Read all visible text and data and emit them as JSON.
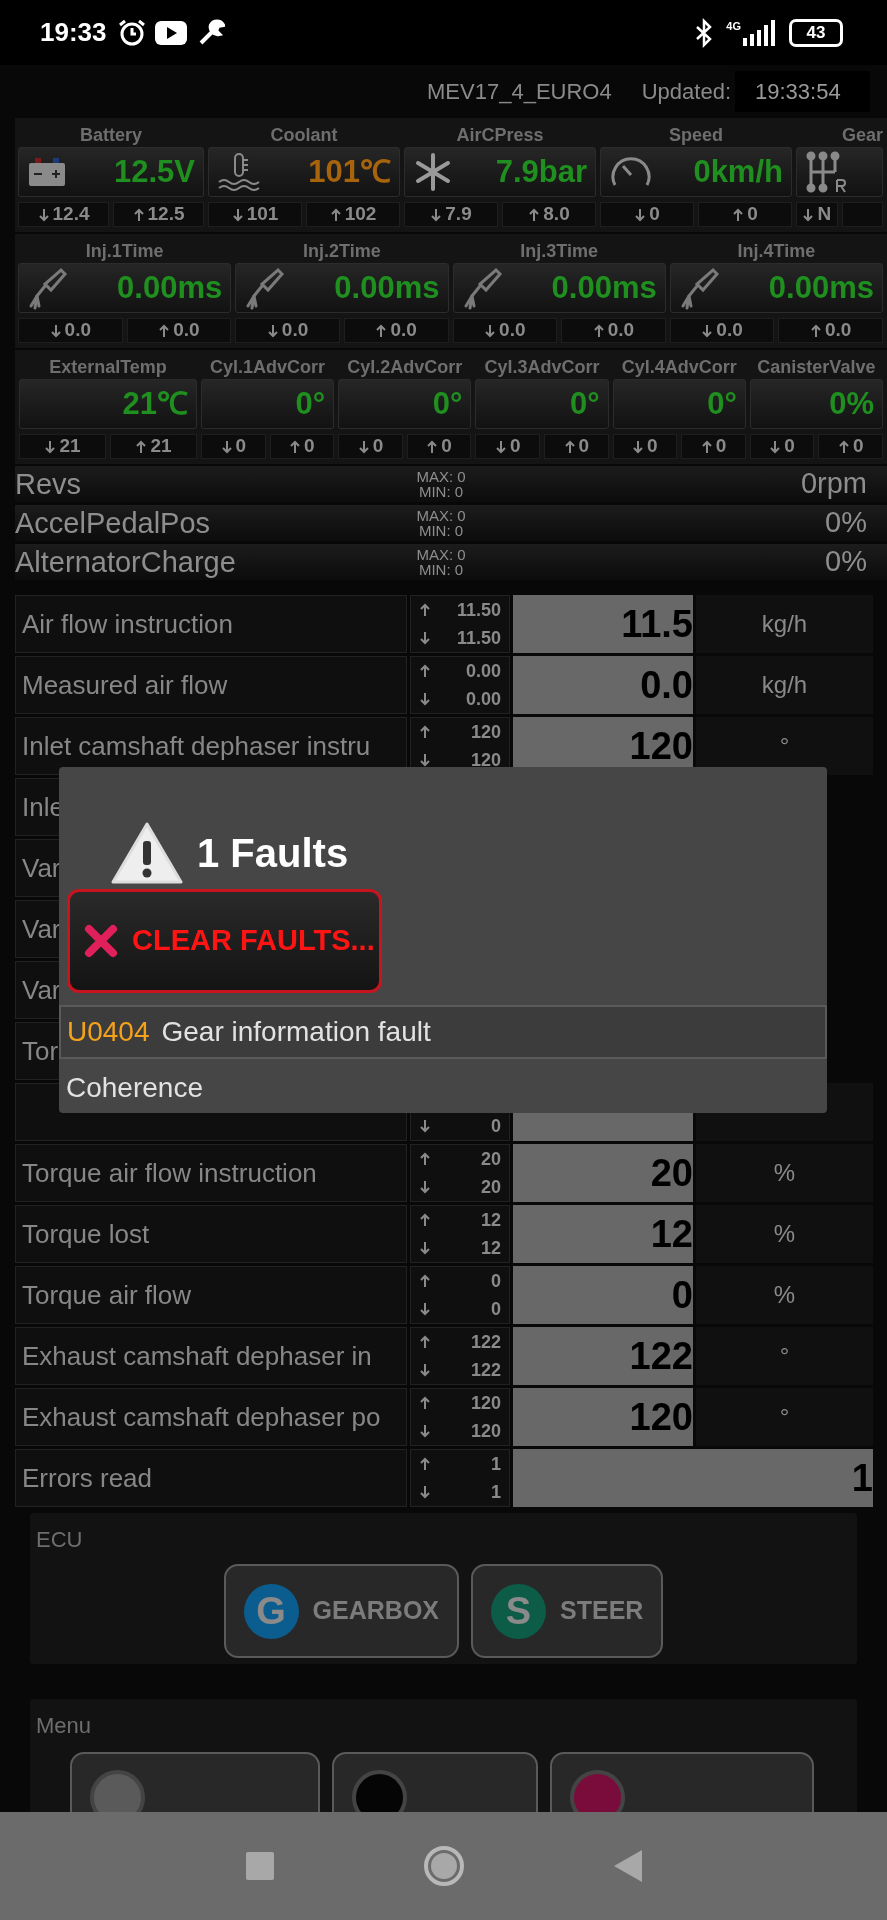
{
  "status_bar": {
    "time": "19:33",
    "network": "4G",
    "battery": "43"
  },
  "header": {
    "ecu": "MEV17_4_EURO4",
    "updated_label": "Updated:",
    "updated_time": "19:33:54"
  },
  "gauge_rows": [
    {
      "gauges": [
        {
          "label": "Battery",
          "kind": "battery",
          "value": "12.5V",
          "color": "#1f8f1f",
          "min": "12.4",
          "max": "12.5"
        },
        {
          "label": "Coolant",
          "kind": "thermometer",
          "value": "101℃",
          "color": "#a8640c",
          "min": "101",
          "max": "102"
        },
        {
          "label": "AirCPress",
          "kind": "snowflake",
          "value": "7.9bar",
          "color": "#1f8f1f",
          "min": "7.9",
          "max": "8.0"
        },
        {
          "label": "Speed",
          "kind": "speedometer",
          "value": "0km/h",
          "color": "#1f8f1f",
          "min": "0",
          "max": "0"
        },
        {
          "label": "Gear",
          "kind": "gearshift",
          "min": "N"
        }
      ]
    },
    {
      "gauges": [
        {
          "label": "Inj.1Time",
          "kind": "injector",
          "value": "0.00ms",
          "color": "#1f8f1f",
          "min": "0.0",
          "max": "0.0"
        },
        {
          "label": "Inj.2Time",
          "kind": "injector",
          "value": "0.00ms",
          "color": "#1f8f1f",
          "min": "0.0",
          "max": "0.0"
        },
        {
          "label": "Inj.3Time",
          "kind": "injector",
          "value": "0.00ms",
          "color": "#1f8f1f",
          "min": "0.0",
          "max": "0.0"
        },
        {
          "label": "Inj.4Time",
          "kind": "injector",
          "value": "0.00ms",
          "color": "#1f8f1f",
          "min": "0.0",
          "max": "0.0"
        }
      ]
    },
    {
      "gauges": [
        {
          "label": "ExternalTemp",
          "value": "21℃",
          "color": "#1f8f1f",
          "min": "21",
          "max": "21"
        },
        {
          "label": "Cyl.1AdvCorr",
          "value": "0°",
          "color": "#1f8f1f",
          "min": "0",
          "max": "0"
        },
        {
          "label": "Cyl.2AdvCorr",
          "value": "0°",
          "color": "#1f8f1f",
          "min": "0",
          "max": "0"
        },
        {
          "label": "Cyl.3AdvCorr",
          "value": "0°",
          "color": "#1f8f1f",
          "min": "0",
          "max": "0"
        },
        {
          "label": "Cyl.4AdvCorr",
          "value": "0°",
          "color": "#1f8f1f",
          "min": "0",
          "max": "0"
        },
        {
          "label": "CanisterValve",
          "value": "0%",
          "color": "#1f8f1f",
          "min": "0",
          "max": "0"
        }
      ]
    }
  ],
  "bars": [
    {
      "label": "Revs",
      "max": "MAX: 0",
      "min": "MIN: 0",
      "value": "0rpm"
    },
    {
      "label": "AccelPedalPos",
      "max": "MAX: 0",
      "min": "MIN: 0",
      "value": "0%"
    },
    {
      "label": "AlternatorCharge",
      "max": "MAX: 0",
      "min": "MIN: 0",
      "value": "0%"
    }
  ],
  "table": {
    "rows": [
      {
        "name": "Air flow instruction",
        "max": "11.50",
        "min": "11.50",
        "value": "11.5",
        "unit": "kg/h"
      },
      {
        "name": "Measured air flow",
        "max": "0.00",
        "min": "0.00",
        "value": "0.0",
        "unit": "kg/h"
      },
      {
        "name": "Inlet camshaft dephaser instru",
        "max": "120",
        "min": "120",
        "value": "120",
        "unit": "°"
      },
      {
        "name": "Inle"
      },
      {
        "name": "Var"
      },
      {
        "name": "Var"
      },
      {
        "name": "Var"
      },
      {
        "name": "Tor"
      },
      {
        "min": "0"
      },
      {
        "name": "Torque air flow instruction",
        "max": "20",
        "min": "20",
        "value": "20",
        "unit": "%"
      },
      {
        "name": "Torque lost",
        "max": "12",
        "min": "12",
        "value": "12",
        "unit": "%"
      },
      {
        "name": "Torque air flow",
        "max": "0",
        "min": "0",
        "value": "0",
        "unit": "%"
      },
      {
        "name": "Exhaust camshaft dephaser in",
        "max": "122",
        "min": "122",
        "value": "122",
        "unit": "°"
      },
      {
        "name": "Exhaust camshaft dephaser po",
        "max": "120",
        "min": "120",
        "value": "120",
        "unit": "°"
      },
      {
        "name": "Errors read",
        "max": "1",
        "min": "1",
        "value": "1"
      }
    ]
  },
  "dialog": {
    "title": "1 Faults",
    "clear_button": "CLEAR FAULTS...",
    "faults": [
      {
        "code": "U0404",
        "description": "Gear information fault"
      }
    ],
    "detail": "Coherence"
  },
  "ecu": {
    "title": "ECU",
    "buttons": [
      {
        "letter": "G",
        "label": "GEARBOX",
        "color": "#0b5d8f"
      },
      {
        "letter": "S",
        "label": "STEER",
        "color": "#0c5c48"
      }
    ]
  },
  "menu": {
    "title": "Menu",
    "buttons": [
      {
        "color": "#5a5a5a"
      },
      {
        "color": "#050505"
      },
      {
        "color": "#7a0c3c"
      }
    ]
  }
}
